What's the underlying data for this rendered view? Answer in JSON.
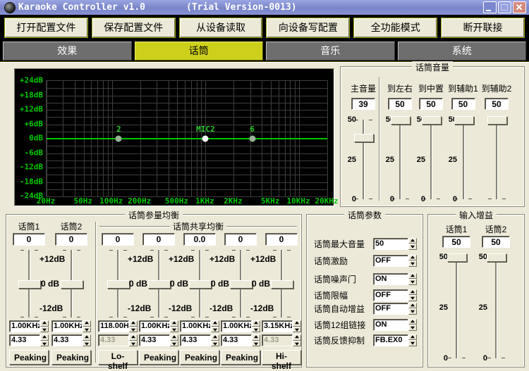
{
  "window": {
    "title": "Karaoke Controller v1.0",
    "trial": "(Trial Version-0013)"
  },
  "toolbar": {
    "buttons": [
      "打开配置文件",
      "保存配置文件",
      "从设备读取",
      "向设备写配置",
      "全功能模式",
      "断开联接"
    ]
  },
  "tabs": {
    "items": [
      "效果",
      "话筒",
      "音乐",
      "系统"
    ],
    "active_index": 1
  },
  "colors": {
    "titlebar": "#7e89cb",
    "tab_active": "#cdd01b",
    "graph_green": "#00c800",
    "panel": "#ece9d8"
  },
  "eq_graph": {
    "fmin": 20,
    "fmax": 20000,
    "db_range": 24,
    "grid_db_step": 3,
    "curve_db": 0,
    "y_ticks": [
      {
        "text": "+24dB",
        "db": 24
      },
      {
        "text": "+18dB",
        "db": 18
      },
      {
        "text": "+12dB",
        "db": 12
      },
      {
        "text": "+6dB",
        "db": 6
      },
      {
        "text": "0dB",
        "db": 0
      },
      {
        "text": "-6dB",
        "db": -6
      },
      {
        "text": "-12dB",
        "db": -12
      },
      {
        "text": "-18dB",
        "db": -18
      },
      {
        "text": "-24dB",
        "db": -24
      }
    ],
    "x_ticks": [
      {
        "text": "20Hz",
        "f": 20
      },
      {
        "text": "50Hz",
        "f": 50
      },
      {
        "text": "100Hz",
        "f": 100
      },
      {
        "text": "200Hz",
        "f": 200
      },
      {
        "text": "500Hz",
        "f": 500
      },
      {
        "text": "1KHz",
        "f": 1000
      },
      {
        "text": "2KHz",
        "f": 2000
      },
      {
        "text": "5KHz",
        "f": 5000
      },
      {
        "text": "10KHz",
        "f": 10000
      },
      {
        "text": "20KHz",
        "f": 20000
      }
    ],
    "points": [
      {
        "label": "2",
        "f": 118,
        "db": 0,
        "selected": false
      },
      {
        "label": "MIC2",
        "f": 1000,
        "db": 0,
        "selected": true
      },
      {
        "label": "6",
        "f": 3150,
        "db": 0,
        "selected": false
      }
    ]
  },
  "mic_volume": {
    "title": "话筒音量",
    "scale": [
      "50",
      "25",
      "0"
    ],
    "sliders": [
      {
        "label": "主音量",
        "value": "39",
        "max": 50
      },
      {
        "label": "到左右",
        "value": "50",
        "max": 50
      },
      {
        "label": "到中置",
        "value": "50",
        "max": 50
      },
      {
        "label": "到辅助1",
        "value": "50",
        "max": 50
      },
      {
        "label": "到辅助2",
        "value": "50",
        "max": 50
      }
    ]
  },
  "param_eq": {
    "title": "话筒参量均衡",
    "shared_title": "话筒共享均衡",
    "headers": [
      "话筒1",
      "话筒2"
    ],
    "slider_scale": [
      "+12dB",
      "0 dB",
      "-12dB"
    ],
    "mic_bands": [
      {
        "gain": "0",
        "freq": "1.00KHz",
        "q": "4.33",
        "type": "Peaking",
        "q_disabled": false
      },
      {
        "gain": "0",
        "freq": "1.00KHz",
        "q": "4.33",
        "type": "Peaking",
        "q_disabled": false
      }
    ],
    "shared_bands": [
      {
        "gain": "0",
        "freq": "118.00H",
        "q": "4.33",
        "type": "Lo-shelf",
        "q_disabled": true
      },
      {
        "gain": "0",
        "freq": "1.00KHz",
        "q": "4.33",
        "type": "Peaking",
        "q_disabled": false
      },
      {
        "gain": "0.0",
        "freq": "1.00KHz",
        "q": "4.33",
        "type": "Peaking",
        "q_disabled": false
      },
      {
        "gain": "0",
        "freq": "1.00KHz",
        "q": "4.33",
        "type": "Peaking",
        "q_disabled": false
      },
      {
        "gain": "0",
        "freq": "3.15KHz",
        "q": "4.33",
        "type": "Hi-shelf",
        "q_disabled": true
      }
    ]
  },
  "mic_params": {
    "title": "话筒参数",
    "rows": [
      {
        "label": "话筒最大音量",
        "value": "50"
      },
      {
        "label": "话筒激励",
        "value": "OFF"
      },
      {
        "label": "话筒噪声门",
        "value": "ON"
      },
      {
        "label": "话筒限幅",
        "value": "OFF"
      },
      {
        "label": "话筒自动增益",
        "value": "OFF"
      },
      {
        "label": "话筒12组链接",
        "value": "ON"
      },
      {
        "label": "话筒反馈抑制",
        "value": "FB.EX0"
      }
    ]
  },
  "input_gain": {
    "title": "输入增益",
    "scale": [
      "50",
      "25",
      "0"
    ],
    "sliders": [
      {
        "label": "话筒1",
        "value": "50",
        "max": 50
      },
      {
        "label": "话筒2",
        "value": "50",
        "max": 50
      }
    ]
  }
}
